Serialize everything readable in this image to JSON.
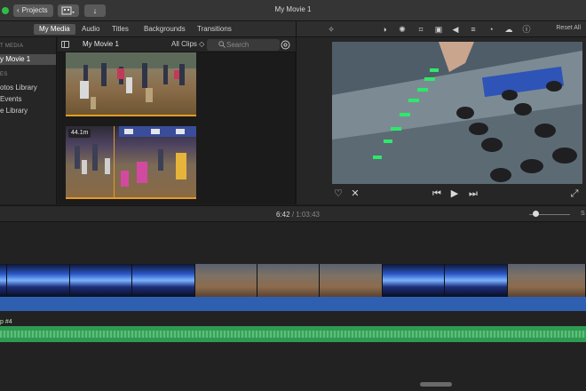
{
  "window": {
    "title": "My Movie 1",
    "projects_label": "Projects",
    "import_glyph": "↓"
  },
  "tabs": [
    {
      "label": "My Media",
      "active": true
    },
    {
      "label": "Audio",
      "active": false
    },
    {
      "label": "Titles",
      "active": false
    },
    {
      "label": "Backgrounds",
      "active": false
    },
    {
      "label": "Transitions",
      "active": false
    }
  ],
  "viewer_toolbar": {
    "icons": [
      "magic-wand-icon",
      "color-balance-icon",
      "color-palette-icon",
      "crop-icon",
      "stabilization-icon",
      "volume-icon",
      "equalizer-icon",
      "speed-icon",
      "noise-reduction-icon",
      "info-icon"
    ],
    "reset_all_label": "Reset All"
  },
  "sidebar": {
    "section_project_media": "T MEDIA",
    "project_item": "y Movie 1",
    "section_libraries": "ES",
    "items": [
      "otos Library",
      "Events",
      "e Library"
    ]
  },
  "browser": {
    "title": "My Movie 1",
    "filter_label": "All Clips ◇",
    "search_placeholder": "Search",
    "clips": [
      {
        "duration": ""
      },
      {
        "duration": "44.1m"
      }
    ]
  },
  "timeline": {
    "current_time": "6:42",
    "separator": "/",
    "total_time": "1:03:43",
    "zoom_label": "S",
    "audio_track_label": "p #4"
  },
  "colors": {
    "accent_orange": "#e39b22",
    "audio_green": "#2f9a52",
    "video_blue": "#2f5fb0",
    "traffic_green": "#2fbd43"
  }
}
